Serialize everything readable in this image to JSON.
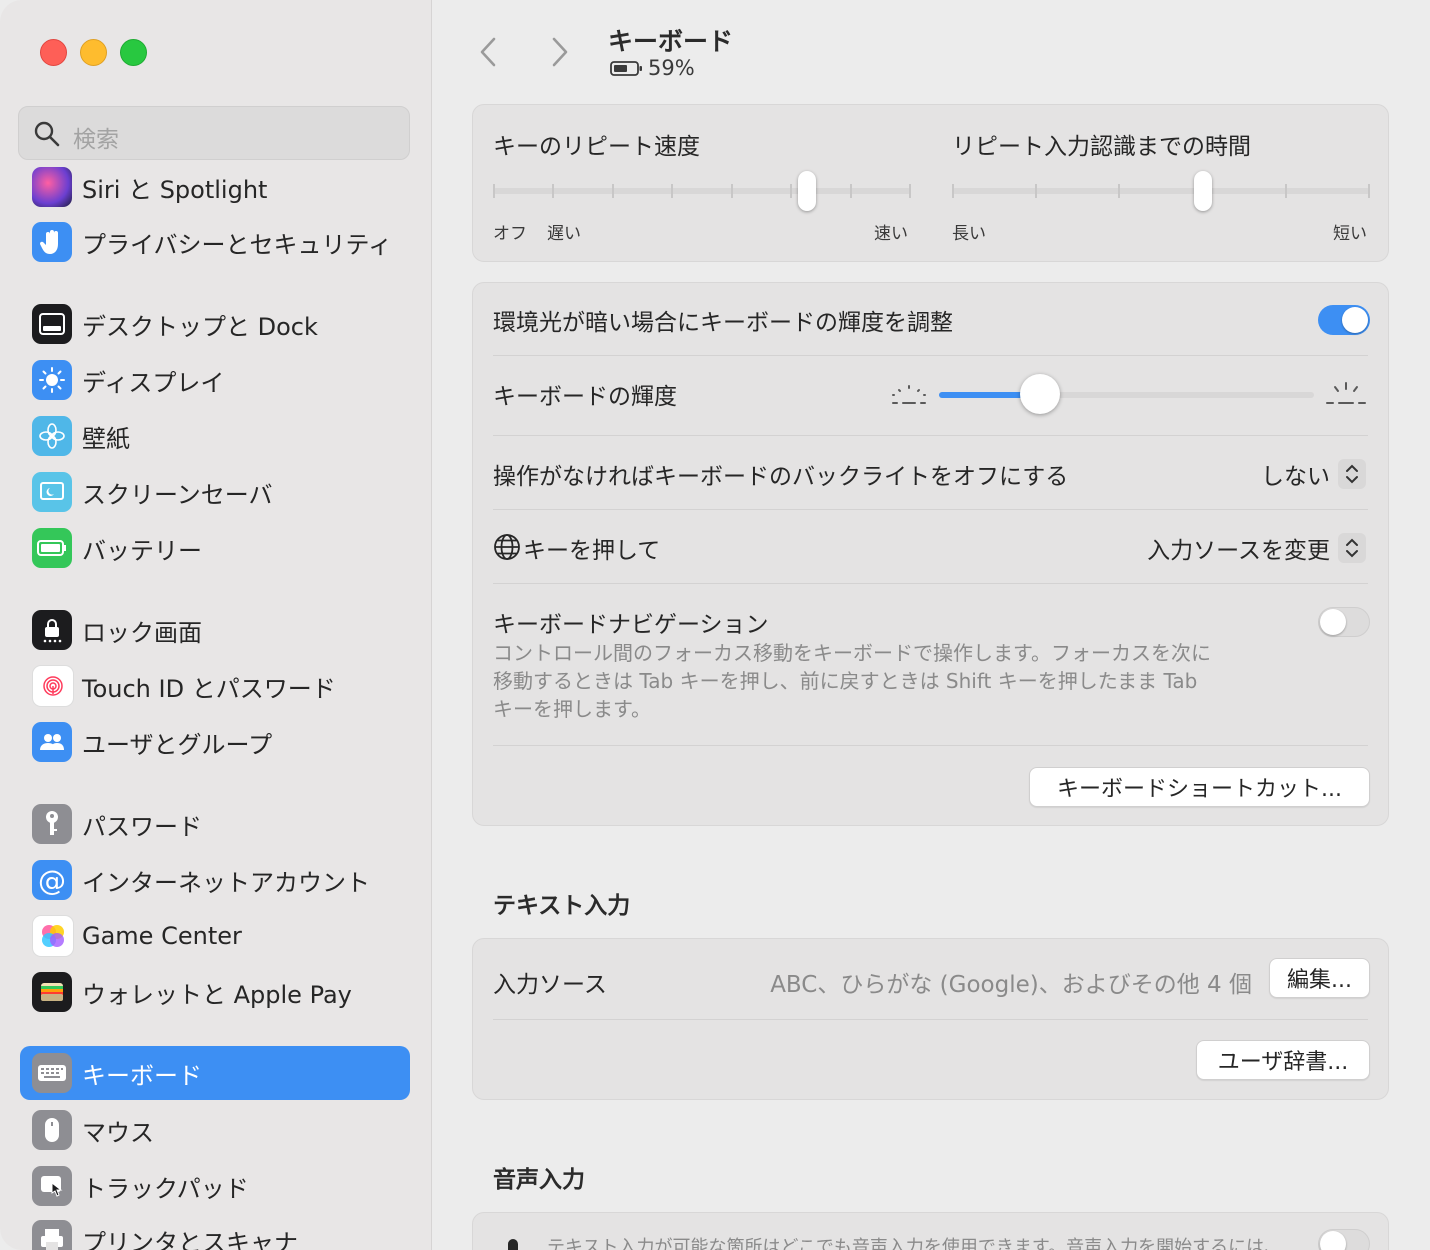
{
  "window": {
    "title": "キーボード",
    "battery": "59%"
  },
  "sidebar": {
    "search_placeholder": "検索",
    "items": [
      {
        "label": "Siri と Spotlight",
        "icon": "siri-icon",
        "color": "#6b3fd1"
      },
      {
        "label": "プライバシーとセキュリティ",
        "icon": "hand-icon",
        "color": "#3d8ff3"
      },
      {
        "label": "デスクトップと Dock",
        "icon": "dock-icon",
        "color": "#1c1c1e"
      },
      {
        "label": "ディスプレイ",
        "icon": "sun-icon",
        "color": "#3d8ff3"
      },
      {
        "label": "壁紙",
        "icon": "flower-icon",
        "color": "#4fb7e8"
      },
      {
        "label": "スクリーンセーバ",
        "icon": "screensaver-icon",
        "color": "#59c4e8"
      },
      {
        "label": "バッテリー",
        "icon": "battery-icon",
        "color": "#34c759"
      },
      {
        "label": "ロック画面",
        "icon": "lock-icon",
        "color": "#1c1c1e"
      },
      {
        "label": "Touch ID とパスワード",
        "icon": "fingerprint-icon",
        "color": "#ffffff"
      },
      {
        "label": "ユーザとグループ",
        "icon": "users-icon",
        "color": "#3d8ff3"
      },
      {
        "label": "パスワード",
        "icon": "key-icon",
        "color": "#8e8e93"
      },
      {
        "label": "インターネットアカウント",
        "icon": "at-icon",
        "color": "#3d8ff3"
      },
      {
        "label": "Game Center",
        "icon": "game-center-icon",
        "color": "#ffffff"
      },
      {
        "label": "ウォレットと Apple Pay",
        "icon": "wallet-icon",
        "color": "#1c1c1e"
      },
      {
        "label": "キーボード",
        "icon": "keyboard-icon",
        "color": "#8e8e93",
        "active": true
      },
      {
        "label": "マウス",
        "icon": "mouse-icon",
        "color": "#8e8e93"
      },
      {
        "label": "トラックパッド",
        "icon": "trackpad-icon",
        "color": "#8e8e93"
      },
      {
        "label": "プリンタとスキャナ",
        "icon": "printer-icon",
        "color": "#8e8e93"
      }
    ]
  },
  "repeat": {
    "rate_label": "キーのリピート速度",
    "rate_off": "オフ",
    "rate_slow": "遅い",
    "rate_fast": "速い",
    "rate_value": 0.75,
    "delay_label": "リピート入力認識までの時間",
    "delay_long": "長い",
    "delay_short": "短い",
    "delay_value": 0.6
  },
  "settings": {
    "ambient_label": "環境光が暗い場合にキーボードの輝度を調整",
    "ambient_on": true,
    "brightness_label": "キーボードの輝度",
    "brightness_value": 0.27,
    "backlight_label": "操作がなければキーボードのバックライトをオフにする",
    "backlight_value": "しない",
    "globe_label": "キーを押して",
    "globe_value": "入力ソースを変更",
    "nav_label": "キーボードナビゲーション",
    "nav_desc": "コントロール間のフォーカス移動をキーボードで操作します。フォーカスを次に移動するときは Tab キーを押し、前に戻すときは Shift キーを押したまま Tab キーを押します。",
    "nav_on": false,
    "shortcuts_button": "キーボードショートカット..."
  },
  "text_input": {
    "section_title": "テキスト入力",
    "sources_label": "入力ソース",
    "sources_value": "ABC、ひらがな (Google)、およびその他 4 個",
    "edit_button": "編集...",
    "dictionary_button": "ユーザ辞書..."
  },
  "dictation": {
    "section_title": "音声入力",
    "desc": "テキスト入力が可能な箇所はどこでも音声入力を使用できます。音声入力を開始するには、"
  },
  "colors": {
    "accent": "#3d8ff3"
  }
}
